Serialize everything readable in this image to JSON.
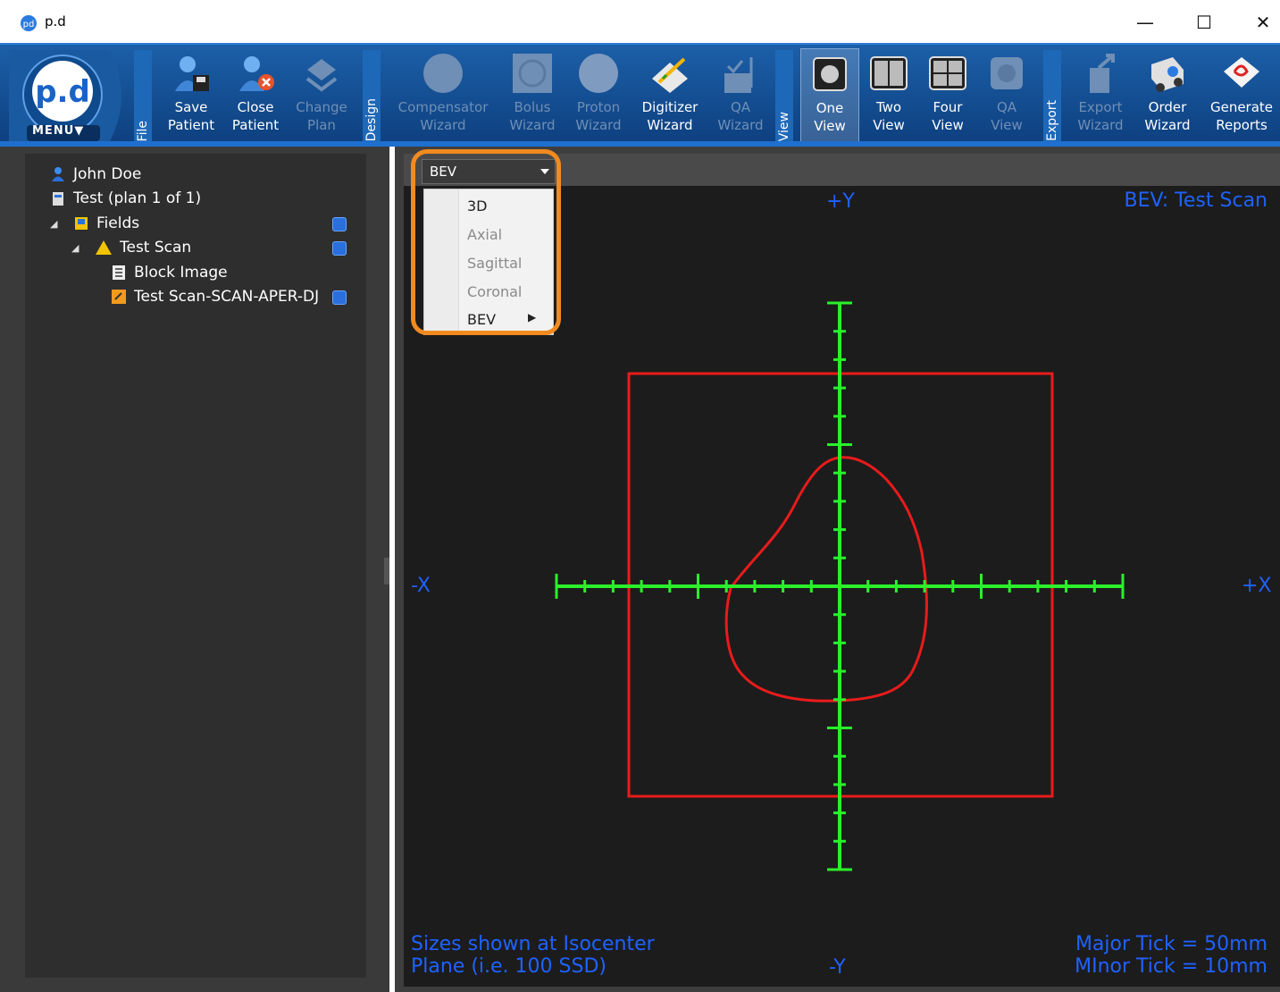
{
  "window": {
    "title": "p.d"
  },
  "window_controls": {
    "minimize": "—",
    "maximize": "☐",
    "close": "✕"
  },
  "ribbon": {
    "menu_label": "MENU▼",
    "groups": [
      "File",
      "Design",
      "View",
      "Export"
    ],
    "buttons": [
      {
        "line1": "Save",
        "line2": "Patient"
      },
      {
        "line1": "Close",
        "line2": "Patient"
      },
      {
        "line1": "Change",
        "line2": "Plan"
      },
      {
        "line1": "Compensator",
        "line2": "Wizard"
      },
      {
        "line1": "Bolus",
        "line2": "Wizard"
      },
      {
        "line1": "Proton",
        "line2": "Wizard"
      },
      {
        "line1": "Digitizer",
        "line2": "Wizard"
      },
      {
        "line1": "QA",
        "line2": "Wizard"
      },
      {
        "line1": "One",
        "line2": "View"
      },
      {
        "line1": "Two",
        "line2": "View"
      },
      {
        "line1": "Four",
        "line2": "View"
      },
      {
        "line1": "QA",
        "line2": "View"
      },
      {
        "line1": "Export",
        "line2": "Wizard"
      },
      {
        "line1": "Order",
        "line2": "Wizard"
      },
      {
        "line1": "Generate",
        "line2": "Reports"
      }
    ]
  },
  "tree": {
    "items": [
      "John Doe",
      "Test (plan 1 of 1)",
      "Fields",
      "Test Scan",
      "Block Image",
      "Test Scan-SCAN-APER-DJ"
    ]
  },
  "viewer": {
    "view_select": "BEV",
    "dropdown_items": [
      "3D",
      "Axial",
      "Sagittal",
      "Coronal",
      "BEV"
    ],
    "title": "BEV: Test Scan",
    "axis_py": "+Y",
    "axis_ny": "-Y",
    "axis_nx": "-X",
    "axis_px": "+X",
    "note_left_1": "Sizes shown at Isocenter",
    "note_left_2": "Plane (i.e. 100 SSD)",
    "note_right_1": "Major Tick = 50mm",
    "note_right_2": "MInor Tick = 10mm",
    "colors": {
      "field": "#e81b1b",
      "axes": "#2bf02b",
      "labels": "#1f62ff",
      "highlight": "#f18a1f"
    }
  }
}
